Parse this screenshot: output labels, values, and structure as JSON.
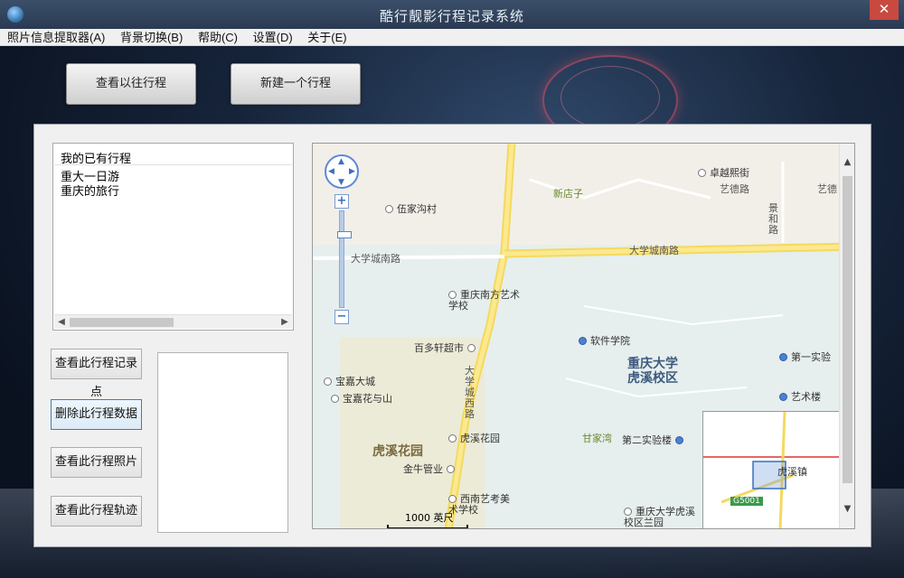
{
  "window": {
    "title": "酷行靓影行程记录系统",
    "close_glyph": "✕"
  },
  "menu": {
    "items": [
      {
        "label": "照片信息提取器(A)"
      },
      {
        "label": "背景切换(B)"
      },
      {
        "label": "帮助(C)"
      },
      {
        "label": "设置(D)"
      },
      {
        "label": "关于(E)"
      }
    ]
  },
  "top_buttons": {
    "view_past": "查看以往行程",
    "new_trip": "新建一个行程"
  },
  "trips": {
    "header": "我的已有行程",
    "items": [
      "重大一日游",
      "重庆的旅行"
    ]
  },
  "actions": {
    "view_points": "查看此行程记录点",
    "delete_trip": "删除此行程数据",
    "view_photos": "查看此行程照片",
    "view_track": "查看此行程轨迹"
  },
  "map": {
    "labels": {
      "wujia": "伍家沟村",
      "xindianzi": "新店子",
      "zhuoyue": "卓越熙街",
      "yide": "艺德路",
      "yide2": "艺德",
      "jinghe": "景和路",
      "dxcnl_left": "大学城南路",
      "dxcnl_right": "大学城南路",
      "dxcxl": "大学城西路",
      "ls_road": "",
      "yishu_school": "重庆南方艺术学校",
      "baiduoxuan": "百多轩超市",
      "ruanjian": "软件学院",
      "cqu": "重庆大学虎溪校区",
      "diyi": "第一实验",
      "yishulou": "艺术楼",
      "baojia": "宝嘉大城",
      "baojia_hua": "宝嘉花与山",
      "huxi_garden": "虎溪花园",
      "huxi_garden_poi": "虎溪花园",
      "jinniu": "金牛管业",
      "ganjiawan": "甘家湾",
      "dier": "第二实验楼",
      "xinan": "西南艺考美术学校",
      "cqu_lanyuan": "重庆大学虎溪校区兰园",
      "scale": "1000 英尺",
      "ov_town": "虎溪镇",
      "ov_shield": "G5001"
    }
  },
  "colors": {
    "accent": "#3c7fb1",
    "road_main": "#f7e07a",
    "campus": "#e6efed"
  }
}
